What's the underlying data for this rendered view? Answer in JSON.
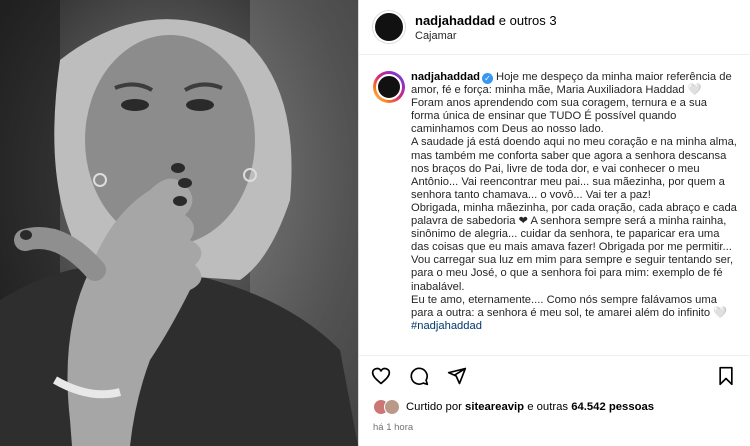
{
  "header": {
    "username": "nadjahaddad",
    "coauthors": " e outros 3",
    "location": "Cajamar"
  },
  "caption": {
    "username": "nadjahaddad",
    "verified_symbol": "✓",
    "lines": [
      "Hoje me despeço da minha maior referência de amor, fé e força: minha mãe, Maria Auxiliadora Haddad 🤍",
      "Foram anos aprendendo com sua coragem, ternura e a sua forma única de ensinar que TUDO É possível quando caminhamos com Deus ao nosso lado.",
      "A saudade já está doendo aqui no meu coração e na minha alma, mas também me conforta saber que agora a senhora descansa nos braços do Pai, livre de toda dor, e vai conhecer o meu Antônio... Vai reencontrar meu pai... sua mãezinha, por quem a senhora tanto chamava... o vovô... Vai ter a paz!",
      "Obrigada, minha mãezinha, por cada oração, cada abraço e cada palavra de sabedoria ❤ A senhora sempre será a minha rainha, sinônimo de alegria... cuidar da senhora, te paparicar era uma das coisas que eu mais amava fazer! Obrigada por me permitir...",
      "Vou carregar sua luz em mim para sempre e seguir tentando ser, para o meu José, o que a senhora foi para mim: exemplo de fé inabalável.",
      "Eu te amo, eternamente.... Como nós sempre falávamos uma para a outra: a senhora é meu sol, te amarei além do infinito 🤍"
    ],
    "hashtag": "#nadjahaddad"
  },
  "likes": {
    "prefix": "Curtido por ",
    "user": "siteareavip",
    "middle": " e outras ",
    "count": "64.542 pessoas"
  },
  "timestamp": "há 1 hora",
  "icons": [
    "heart-icon",
    "comment-icon",
    "share-icon",
    "bookmark-icon"
  ]
}
